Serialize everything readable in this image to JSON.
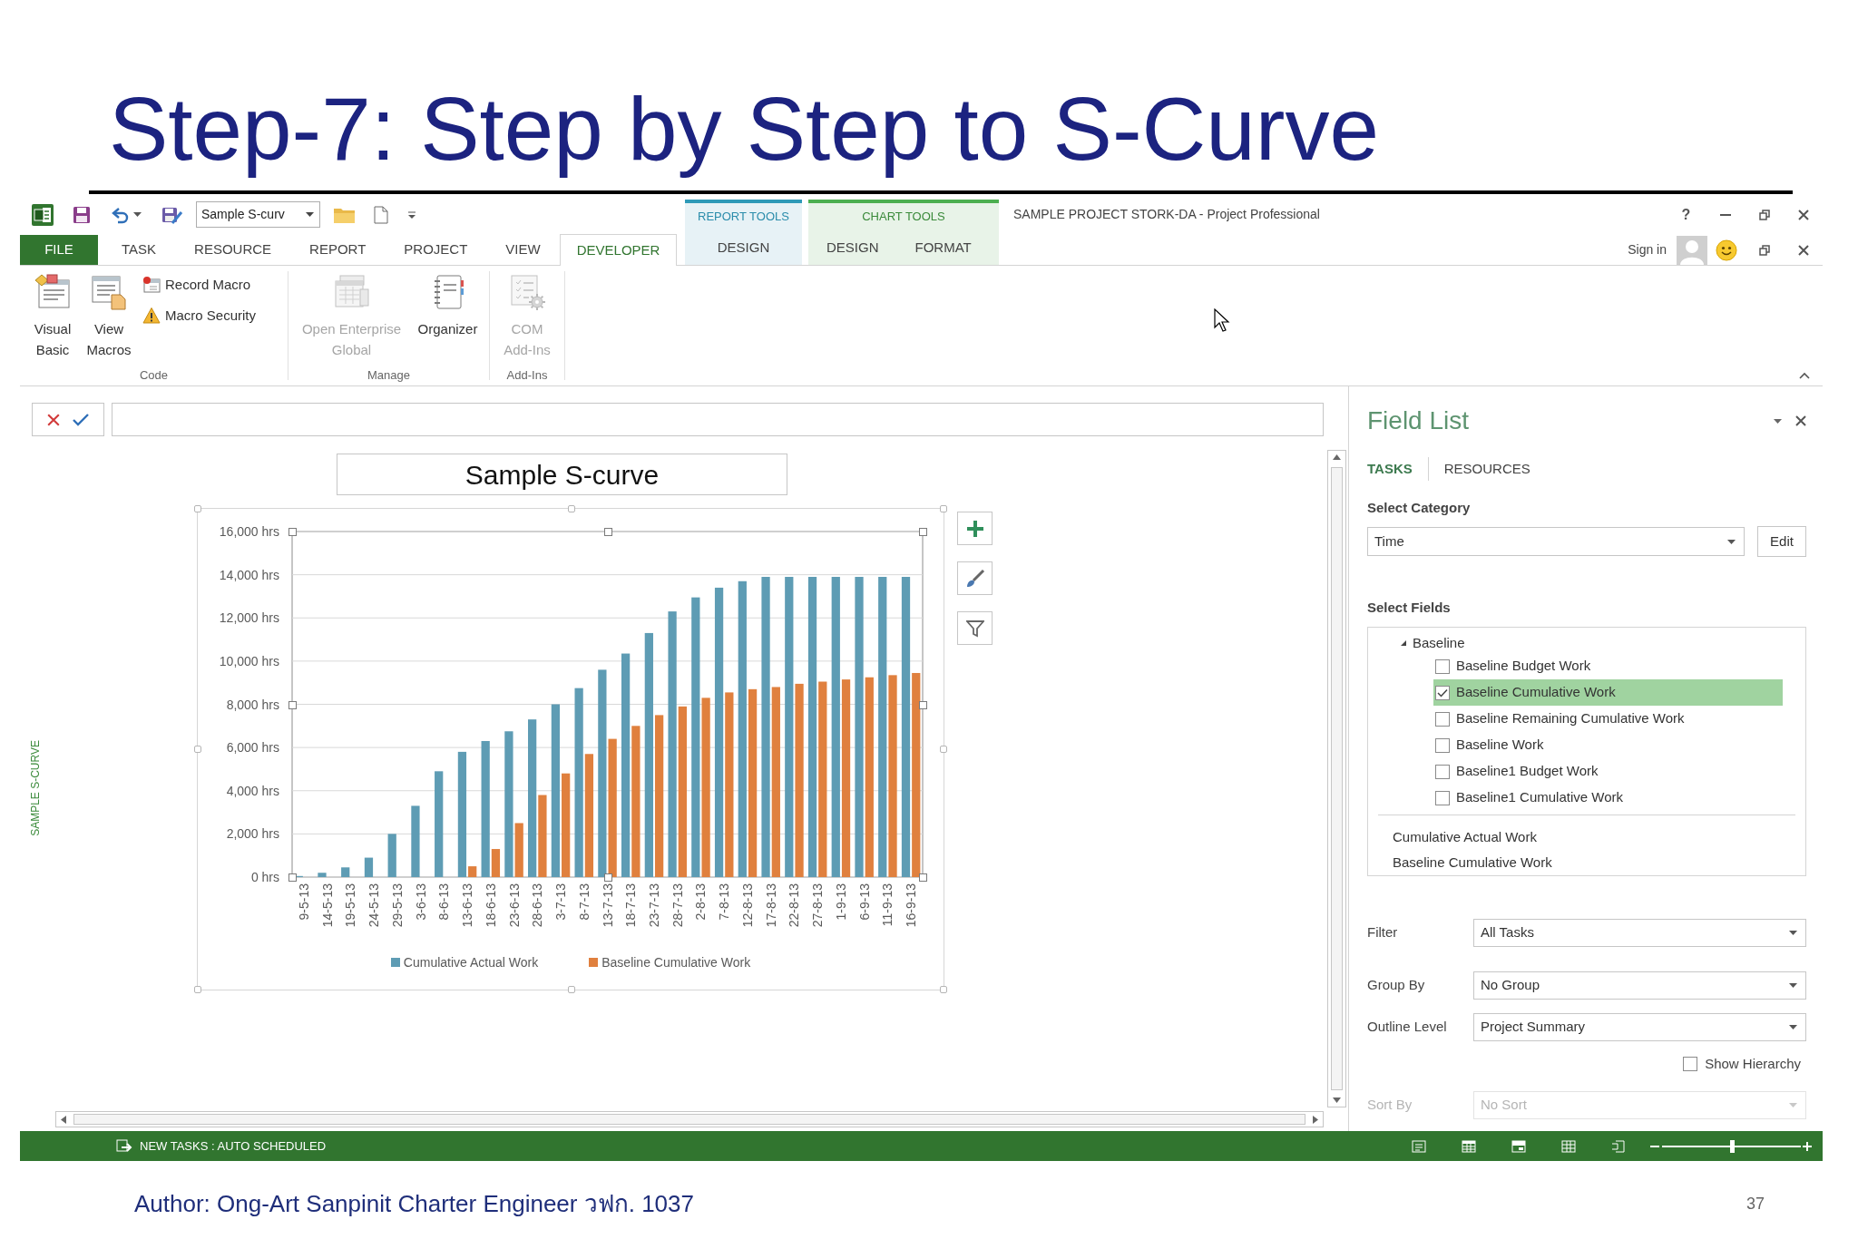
{
  "slide": {
    "title": "Step-7: Step by Step to S-Curve"
  },
  "window": {
    "title": "SAMPLE PROJECT STORK-DA - Project Professional",
    "help": "?",
    "sign_in": "Sign in"
  },
  "quick_access": {
    "document_box": {
      "value": "Sample S-curv"
    }
  },
  "ribbon_tabs": [
    {
      "label": "FILE",
      "kind": "file",
      "selected": false
    },
    {
      "label": "TASK",
      "kind": "tab",
      "selected": false
    },
    {
      "label": "RESOURCE",
      "kind": "tab",
      "selected": false
    },
    {
      "label": "REPORT",
      "kind": "tab",
      "selected": false
    },
    {
      "label": "PROJECT",
      "kind": "tab",
      "selected": false
    },
    {
      "label": "VIEW",
      "kind": "tab",
      "selected": false
    },
    {
      "label": "DEVELOPER",
      "kind": "tab",
      "selected": true
    }
  ],
  "contextual_tabs": [
    {
      "label": "REPORT TOOLS",
      "tabs": [
        {
          "label": "DESIGN",
          "selected": false
        }
      ]
    },
    {
      "label": "CHART TOOLS",
      "tabs": [
        {
          "label": "DESIGN",
          "selected": false
        },
        {
          "label": "FORMAT",
          "selected": false
        }
      ]
    }
  ],
  "ribbon": {
    "groups": [
      {
        "label": "Code",
        "commands": [
          {
            "label": "Visual Basic",
            "kind": "large",
            "disabled": false
          },
          {
            "label": "View Macros",
            "kind": "large",
            "disabled": false
          },
          {
            "label": "Record Macro",
            "kind": "small",
            "disabled": false
          },
          {
            "label": "Macro Security",
            "kind": "small",
            "disabled": false
          }
        ]
      },
      {
        "label": "Manage",
        "commands": [
          {
            "label": "Open Enterprise Global",
            "kind": "large",
            "disabled": true
          },
          {
            "label": "Organizer",
            "kind": "large",
            "disabled": false
          }
        ]
      },
      {
        "label": "Add-Ins",
        "commands": [
          {
            "label": "COM Add-Ins",
            "kind": "large",
            "disabled": true
          }
        ]
      }
    ]
  },
  "view": {
    "side_label": "SAMPLE S-CURVE",
    "report_title": "Sample S-curve",
    "chart_data": {
      "type": "bar",
      "categories": [
        "9-5-13",
        "14-5-13",
        "19-5-13",
        "24-5-13",
        "29-5-13",
        "3-6-13",
        "8-6-13",
        "13-6-13",
        "18-6-13",
        "23-6-13",
        "28-6-13",
        "3-7-13",
        "8-7-13",
        "13-7-13",
        "18-7-13",
        "23-7-13",
        "28-7-13",
        "2-8-13",
        "7-8-13",
        "12-8-13",
        "17-8-13",
        "22-8-13",
        "27-8-13",
        "1-9-13",
        "6-9-13",
        "11-9-13",
        "16-9-13"
      ],
      "series": [
        {
          "name": "Cumulative Actual Work",
          "color": "#5e9cb4",
          "values": [
            50,
            200,
            450,
            900,
            2000,
            3300,
            4900,
            5800,
            6300,
            6750,
            7300,
            8000,
            8750,
            9600,
            10350,
            11300,
            12300,
            12950,
            13400,
            13700,
            13900,
            13900,
            13900,
            13900,
            13900,
            13900,
            13900
          ]
        },
        {
          "name": "Baseline Cumulative Work",
          "color": "#e0803e",
          "values": [
            0,
            0,
            0,
            0,
            0,
            0,
            0,
            500,
            1300,
            2500,
            3800,
            4800,
            5700,
            6400,
            7000,
            7500,
            7900,
            8300,
            8550,
            8700,
            8800,
            8950,
            9050,
            9150,
            9250,
            9350,
            9450
          ]
        }
      ],
      "ylim": [
        0,
        16000
      ],
      "yticks": [
        {
          "value": 0,
          "label": "0 hrs"
        },
        {
          "value": 2000,
          "label": "2,000 hrs"
        },
        {
          "value": 4000,
          "label": "4,000 hrs"
        },
        {
          "value": 6000,
          "label": "6,000 hrs"
        },
        {
          "value": 8000,
          "label": "8,000 hrs"
        },
        {
          "value": 10000,
          "label": "10,000 hrs"
        },
        {
          "value": 12000,
          "label": "12,000 hrs"
        },
        {
          "value": 14000,
          "label": "14,000 hrs"
        },
        {
          "value": 16000,
          "label": "16,000 hrs"
        }
      ],
      "stacked": false,
      "orientation": "vertical",
      "grid": true,
      "legend": "bottom"
    }
  },
  "field_list": {
    "title": "Field List",
    "tabs": [
      {
        "label": "TASKS",
        "selected": true
      },
      {
        "label": "RESOURCES",
        "selected": false
      }
    ],
    "category_label": "Select Category",
    "category": {
      "value": "Time"
    },
    "edit_button": "Edit",
    "fields_label": "Select Fields",
    "tree": [
      {
        "label": "Baseline",
        "expanded": true,
        "children": [
          {
            "label": "Baseline Budget Work",
            "checked": false,
            "selected": false
          },
          {
            "label": "Baseline Cumulative Work",
            "checked": true,
            "selected": true
          },
          {
            "label": "Baseline Remaining Cumulative Work",
            "checked": false,
            "selected": false
          },
          {
            "label": "Baseline Work",
            "checked": false,
            "selected": false
          },
          {
            "label": "Baseline1 Budget Work",
            "checked": false,
            "selected": false
          },
          {
            "label": "Baseline1 Cumulative Work",
            "checked": false,
            "selected": false
          }
        ]
      }
    ],
    "chosen_fields": [
      "Cumulative Actual Work",
      "Baseline Cumulative Work"
    ],
    "settings": [
      {
        "kind": "dropdown",
        "label": "Filter",
        "value": "All Tasks",
        "disabled": false
      },
      {
        "kind": "dropdown",
        "label": "Group By",
        "value": "No Group",
        "disabled": false
      },
      {
        "kind": "dropdown",
        "label": "Outline Level",
        "value": "Project Summary",
        "disabled": false
      },
      {
        "kind": "checkbox",
        "label": "Show Hierarchy",
        "checked": false
      },
      {
        "kind": "dropdown",
        "label": "Sort By",
        "value": "No Sort",
        "disabled": true
      }
    ]
  },
  "status_bar": {
    "task_mode": "NEW TASKS : AUTO SCHEDULED",
    "zoom": {
      "level": 0.5
    }
  },
  "footer": {
    "author": "Author: Ong-Art Sanpinit Charter Engineer วฟก. 1037",
    "page_number": "37"
  }
}
